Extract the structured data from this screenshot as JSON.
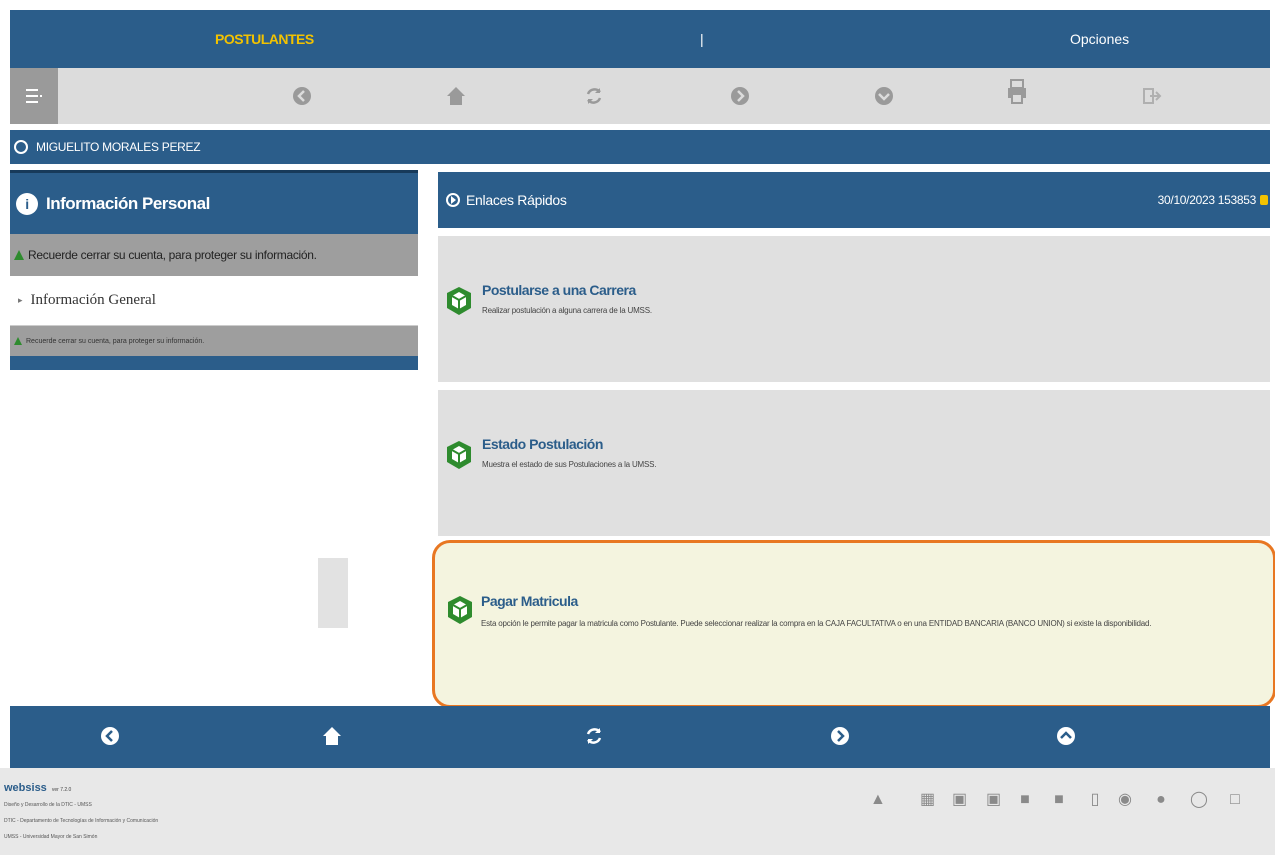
{
  "topbar": {
    "tab_postulantes": "POSTULANTES",
    "tab_separator": "|",
    "tab_opciones": "Opciones"
  },
  "toolbar": {
    "icons": [
      "menu-icon",
      "back-icon",
      "home-icon",
      "refresh-icon",
      "forward-icon",
      "down-icon",
      "print-icon",
      "logout-icon"
    ]
  },
  "user": {
    "name": "MIGUELITO MORALES PEREZ"
  },
  "left_panel": {
    "title": "Información Personal",
    "warning": "Recuerde cerrar su cuenta, para proteger su información.",
    "item": "Información General",
    "warning_small": "Recuerde cerrar su cuenta, para proteger su información."
  },
  "quick_links": {
    "title": "Enlaces Rápidos",
    "datetime": "30/10/2023 153853",
    "cards": [
      {
        "title": "Postularse a una Carrera",
        "desc": "Realizar postulación a alguna carrera de la UMSS."
      },
      {
        "title": "Estado Postulación",
        "desc": "Muestra el estado de sus Postulaciones a la UMSS."
      },
      {
        "title": "Pagar Matricula",
        "desc": "Esta opción le permite pagar la matricula como Postulante. Puede seleccionar realizar la compra en la CAJA FACULTATIVA o en una ENTIDAD BANCARIA (BANCO UNION) si existe la disponibilidad."
      }
    ]
  },
  "footer": {
    "brand": "websiss",
    "brand_sub": "ver 7.2.0",
    "lines": [
      "Diseño y Desarrollo de la DTIC - UMSS",
      "DTIC - Departamento de Tecnologías de Información y Comunicación",
      "UMSS - Universidad Mayor de San Simón"
    ]
  },
  "colors": {
    "primary": "#2b5d8a",
    "accent": "#f2c200",
    "highlight_border": "#e87722",
    "highlight_bg": "#f4f4df",
    "cube": "#2e8b2e"
  }
}
